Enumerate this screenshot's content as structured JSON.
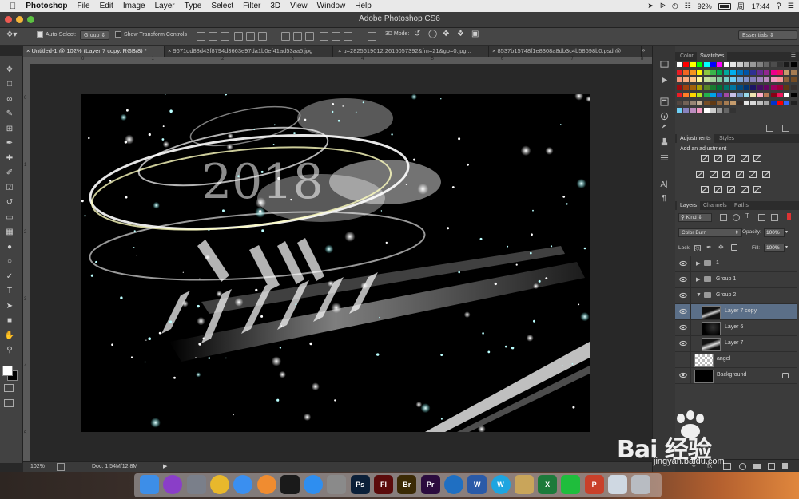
{
  "menubar": {
    "items": [
      "Photoshop",
      "File",
      "Edit",
      "Image",
      "Layer",
      "Type",
      "Select",
      "Filter",
      "3D",
      "View",
      "Window",
      "Help"
    ],
    "battery": "92%",
    "clock": "周一17:44"
  },
  "window": {
    "title": "Adobe Photoshop CS6"
  },
  "options": {
    "auto_select_label": "Auto-Select:",
    "auto_select_value": "Group",
    "transform_label": "Show Transform Controls",
    "mode3d_label": "3D Mode:",
    "workspace": "Essentials"
  },
  "tabs": [
    "Untitled-1 @ 102% (Layer 7 copy, RGB/8) *",
    "9671dd88d43f8794d3663e97da1b0ef41ad53aa5.jpg",
    "u=2825619012,2615057392&fm=21&gp=0.jpg...",
    "8537b15748f1e8308a8db3c4b58698b0.psd @"
  ],
  "ruler": {
    "top_ticks": [
      "0",
      "1",
      "2",
      "3",
      "4",
      "5",
      "6",
      "7",
      "8"
    ],
    "left_ticks": [
      "0",
      "1",
      "2",
      "3",
      "4",
      "5"
    ]
  },
  "status": {
    "zoom": "102%",
    "doc": "Doc: 1.54M/12.8M"
  },
  "panels": {
    "color_tab": "Color",
    "swatches_tab": "Swatches",
    "adjustments_tab": "Adjustments",
    "styles_tab": "Styles",
    "add_adjustment": "Add an adjustment",
    "layers_tab": "Layers",
    "channels_tab": "Channels",
    "paths_tab": "Paths",
    "kind_filter": "Kind",
    "blend_mode": "Color Burn",
    "opacity_label": "Opacity:",
    "opacity_value": "100%",
    "lock_label": "Lock:",
    "fill_label": "Fill:",
    "fill_value": "100%"
  },
  "layers": [
    {
      "name": "1",
      "type": "group",
      "indent": 0,
      "expanded": false,
      "selected": false,
      "visible": true
    },
    {
      "name": "Group 1",
      "type": "group",
      "indent": 0,
      "expanded": false,
      "selected": false,
      "visible": true
    },
    {
      "name": "Group 2",
      "type": "group",
      "indent": 0,
      "expanded": true,
      "selected": false,
      "visible": true
    },
    {
      "name": "Layer 7 copy",
      "type": "layer",
      "indent": 1,
      "selected": true,
      "visible": true
    },
    {
      "name": "Layer 6",
      "type": "layer",
      "indent": 1,
      "selected": false,
      "visible": true
    },
    {
      "name": "Layer 7",
      "type": "layer",
      "indent": 1,
      "selected": false,
      "visible": true
    },
    {
      "name": "angel",
      "type": "layer",
      "indent": 0,
      "selected": false,
      "visible": false
    },
    {
      "name": "Background",
      "type": "layer",
      "indent": 0,
      "selected": false,
      "visible": true,
      "locked": true
    }
  ],
  "swatches": [
    "#ffffff",
    "#000000",
    "#ff0000",
    "#ffff00",
    "#00ff00",
    "#00ffff",
    "#0000ff",
    "#ff00ff",
    "#ed1c24",
    "#f7941d",
    "#fff200",
    "#8dc63f",
    "#00a651",
    "#00aeef",
    "#2e3192",
    "#92278f",
    "#ec008c",
    "#c69c6d",
    "#754c24",
    "#603913",
    "#998675",
    "#736357",
    "#534741",
    "#c7b299"
  ],
  "watermark": {
    "text": "Bai 经验",
    "url": "jingyan.baidu.com"
  },
  "dock": [
    {
      "name": "finder",
      "color": "#3d8ee8"
    },
    {
      "name": "siri",
      "color": "#8a3ec8"
    },
    {
      "name": "launchpad",
      "color": "#7a7f8a"
    },
    {
      "name": "chrome",
      "color": "#e8b82c"
    },
    {
      "name": "safari",
      "color": "#3a8ff0"
    },
    {
      "name": "photos",
      "color": "#f08c30"
    },
    {
      "name": "qq",
      "color": "#1a1a1a"
    },
    {
      "name": "appstore",
      "color": "#2e8ef0"
    },
    {
      "name": "sysprefs",
      "color": "#8a8a8a"
    },
    {
      "name": "photoshop",
      "label": "Ps",
      "color": "#0b1f38"
    },
    {
      "name": "flash",
      "label": "Fl",
      "color": "#5b0b0b"
    },
    {
      "name": "bridge",
      "label": "Br",
      "color": "#3b2a05"
    },
    {
      "name": "premiere",
      "label": "Pr",
      "color": "#2b0b3e"
    },
    {
      "name": "browser",
      "color": "#1f6fc2"
    },
    {
      "name": "word",
      "label": "W",
      "color": "#2a5aa8"
    },
    {
      "name": "wps",
      "label": "W",
      "color": "#1ea5e0"
    },
    {
      "name": "archive",
      "color": "#c9a55a"
    },
    {
      "name": "excel",
      "label": "X",
      "color": "#1d7a3a"
    },
    {
      "name": "iqiyi",
      "color": "#1fbd3c"
    },
    {
      "name": "powerpoint",
      "label": "P",
      "color": "#c9402a"
    },
    {
      "name": "preview",
      "color": "#cfd8e2"
    },
    {
      "name": "trash",
      "color": "#b8bcc2"
    }
  ]
}
